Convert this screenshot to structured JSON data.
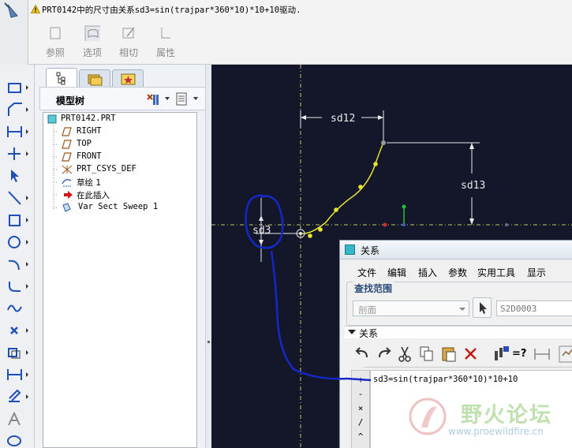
{
  "message": {
    "text": "PRT0142中的尺寸由关系sd3=sin(trajpar*360*10)*10+10驱动."
  },
  "dashboard": {
    "buttons": [
      {
        "label": "参照"
      },
      {
        "label": "选项"
      },
      {
        "label": "相切"
      },
      {
        "label": "属性"
      }
    ]
  },
  "model_tree": {
    "title": "模型树",
    "items": [
      {
        "label": "PRT0142.PRT",
        "icon": "part-icon"
      },
      {
        "label": "RIGHT",
        "icon": "datum-plane-icon"
      },
      {
        "label": "TOP",
        "icon": "datum-plane-icon"
      },
      {
        "label": "FRONT",
        "icon": "datum-plane-icon"
      },
      {
        "label": "PRT_CSYS_DEF",
        "icon": "csys-icon"
      },
      {
        "label": "草绘 1",
        "icon": "sketch-icon"
      },
      {
        "label": "在此插入",
        "icon": "insert-arrow-icon"
      },
      {
        "label": "Var Sect Sweep 1",
        "icon": "var-sect-sweep-icon"
      }
    ]
  },
  "sketch": {
    "dimensions": [
      "sd12",
      "sd13",
      "sd3"
    ]
  },
  "relations_dialog": {
    "title": "关系",
    "menu": [
      "文件",
      "编辑",
      "插入",
      "参数",
      "实用工具",
      "显示"
    ],
    "find_scope_label": "查找范围",
    "scope_value": "剖面",
    "section_value": "S2D0003",
    "relations_section_label": "关系",
    "side_operators": [
      "+",
      "-",
      "×",
      "/",
      "^"
    ],
    "eval_symbol": "=?",
    "relation_text": "sd3=sin(trajpar*360*10)*10+10"
  },
  "watermark": {
    "title": "野火论坛",
    "url": "www.proewildfire.cn"
  },
  "colors": {
    "graphics_background": "#14162a",
    "sketch_curve": "#e6e62c",
    "annotation_ink": "#1428c8"
  }
}
